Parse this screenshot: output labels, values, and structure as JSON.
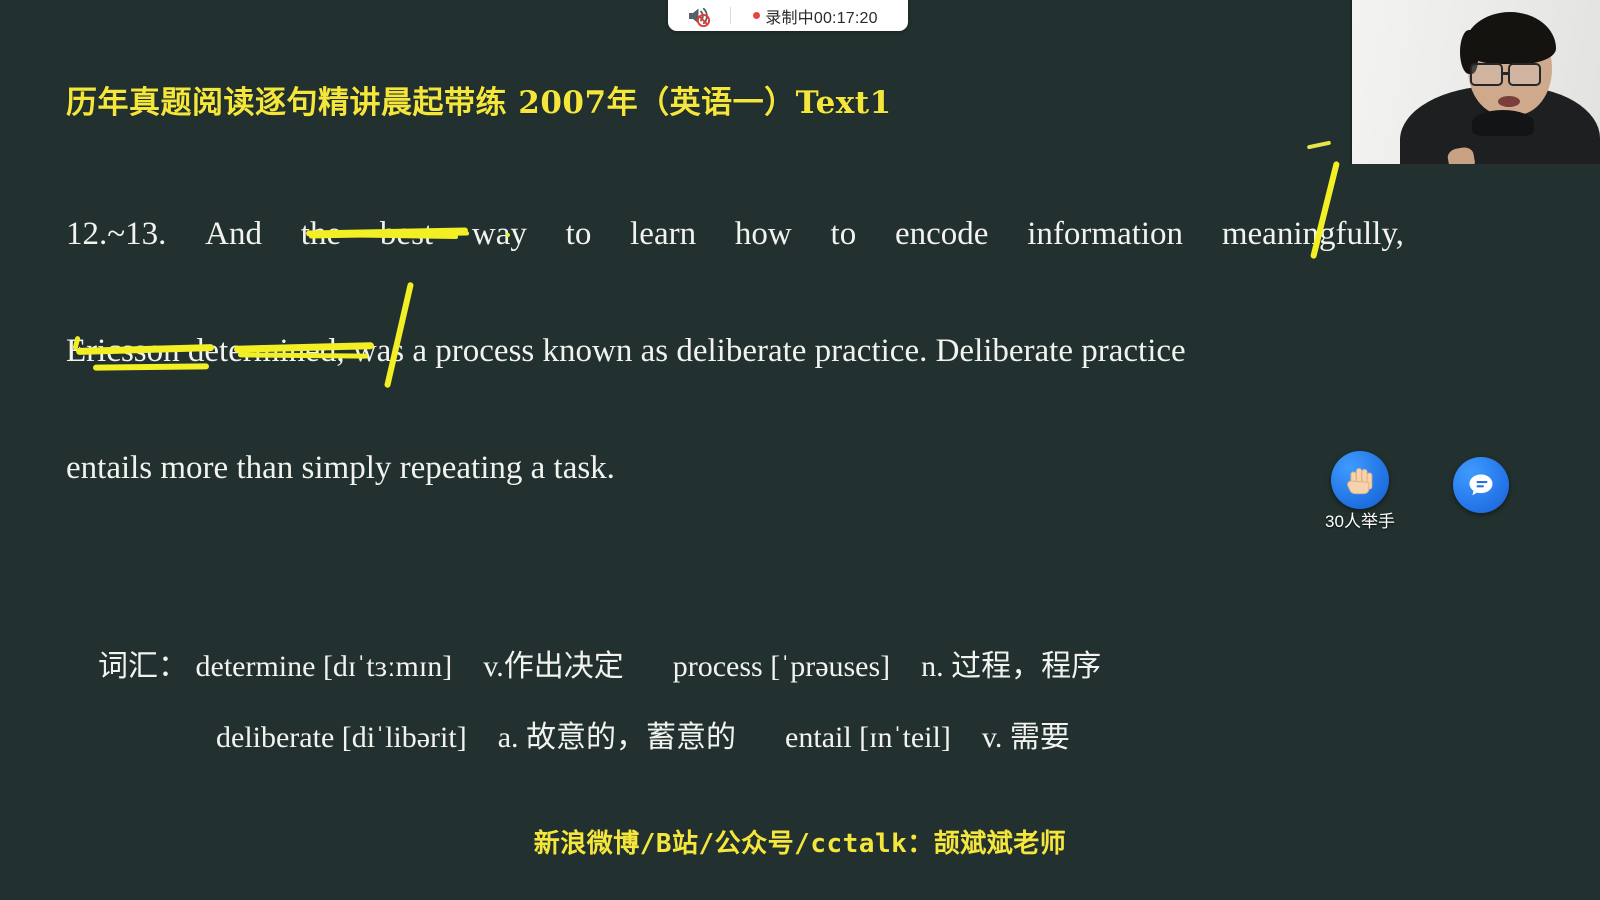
{
  "recording_bar": {
    "mute_icon": "speaker-muted-icon",
    "status_text": "录制中00:17:20",
    "dot_color": "#e8453c"
  },
  "webcam": {
    "label": "presenter-webcam"
  },
  "slide": {
    "background_color": "#22312f",
    "title": "历年真题阅读逐句精讲晨起带练 2007年（英语一）Text1",
    "title_color": "#f5e63c",
    "body_color": "#f2f3ef",
    "annotation_color": "#f2ef24",
    "paragraph": {
      "line1_a": "12.~13.",
      "line1_b": "And",
      "line1_c": "the",
      "line1_d": "best",
      "line1_e": "way",
      "line1_f": "to",
      "line1_g": "learn",
      "line1_h": "how",
      "line1_i": "to",
      "line1_j": "encode",
      "line1_k": "information",
      "line1_l": "meaningfully,",
      "line2": "Ericsson determined, was a process known as deliberate practice. Deliberate practice",
      "line2_a": "Ericsson determined,",
      "line2_b": " was a process known as deliberate practice. Deliberate practice",
      "line3": "entails more than simply repeating a task."
    },
    "vocabulary": {
      "line1_label": "词汇：",
      "line1_word1": "determine [dɪˈtɜːmɪn]",
      "line1_def1": "v.作出决定",
      "line1_word2": "process [ˈprəuses]",
      "line1_def2": "n. 过程，程序",
      "line2_word1": "deliberate [diˈlibərit]",
      "line2_def1": "a. 故意的，蓄意的",
      "line2_word2": "entail [ɪnˈteil]",
      "line2_def2": "v. 需要"
    },
    "footer": "新浪微博/B站/公众号/cctalk：颉斌斌老师"
  },
  "controls": {
    "raise_hand_label": "30人举手",
    "raise_hand_icon": "raised-hand-icon",
    "chat_icon": "chat-bubble-icon",
    "button_color": "#2272e6"
  }
}
